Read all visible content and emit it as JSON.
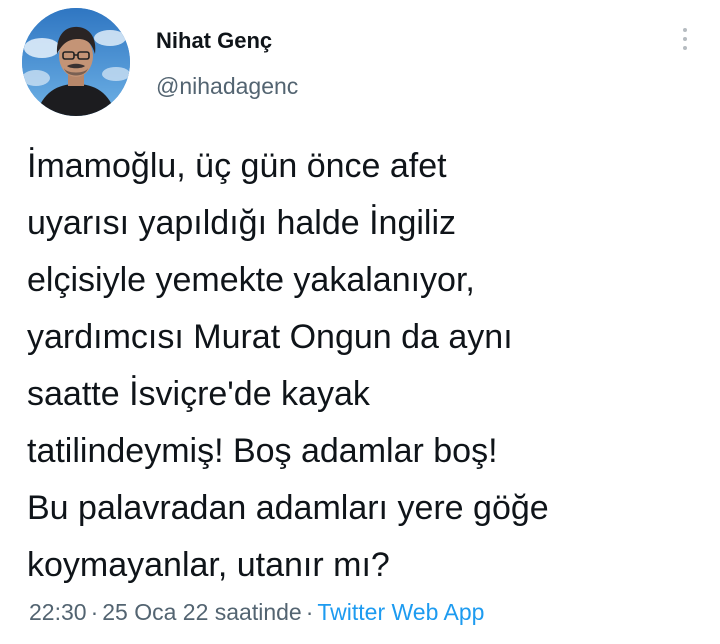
{
  "author": {
    "display_name": "Nihat Genç",
    "handle": "@nihadagenc",
    "avatar_icon": "profile-photo"
  },
  "more_icon": "more-vertical-icon",
  "tweet": {
    "lines": [
      "İmamoğlu, üç gün önce afet",
      "uyarısı yapıldığı halde İngiliz",
      "elçisiyle yemekte yakalanıyor,",
      "yardımcısı Murat Ongun da aynı",
      "saatte İsviçre'de kayak",
      "tatilindeymiş! Boş adamlar boş!",
      "Bu palavradan adamları yere göğe",
      "koymayanlar, utanır mı?"
    ]
  },
  "meta": {
    "time": "22:30",
    "separator": "·",
    "date": "25 Oca 22 saatinde",
    "source": "Twitter Web App"
  },
  "colors": {
    "text": "#0f1419",
    "secondary": "#536471",
    "link": "#1d9bf0"
  }
}
